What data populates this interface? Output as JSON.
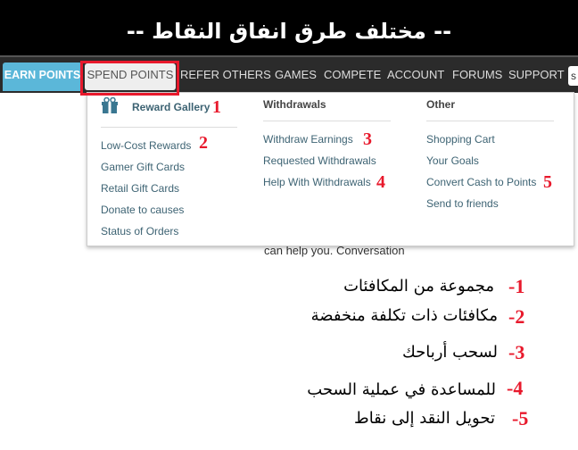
{
  "title": "-- مختلف طرق انفاق النقاط --",
  "nav": {
    "items": [
      "EARN POINTS",
      "SPEND POINTS",
      "REFER OTHERS",
      "GAMES",
      "COMPETE",
      "ACCOUNT",
      "FORUMS",
      "SUPPORT"
    ],
    "search_partial": "s"
  },
  "dropdown": {
    "col1": {
      "header": "Reward Gallery",
      "items": [
        "Low-Cost Rewards",
        "Gamer Gift Cards",
        "Retail Gift Cards",
        "Donate to causes",
        "Status of Orders"
      ]
    },
    "col2": {
      "header": "Withdrawals",
      "items": [
        "Withdraw Earnings",
        "Requested Withdrawals",
        "Help With Withdrawals"
      ]
    },
    "col3": {
      "header": "Other",
      "items": [
        "Shopping Cart",
        "Your Goals",
        "Convert Cash to Points",
        "Send to friends"
      ]
    },
    "markers": [
      "1",
      "2",
      "3",
      "4",
      "5"
    ]
  },
  "behind_text": "can help you. Conversation",
  "legend": [
    {
      "num": "-1",
      "text": "مجموعة من المكافئات"
    },
    {
      "num": "-2",
      "text": "مكافئات ذات تكلفة منخفضة"
    },
    {
      "num": "-3",
      "text": "لسحب أرباحك"
    },
    {
      "num": "-4",
      "text": "للمساعدة في عملية السحب"
    },
    {
      "num": "-5",
      "text": "تحويل النقد إلى نقاط"
    }
  ],
  "colors": {
    "accent": "#5bb7d9",
    "highlight": "#e8192c",
    "link": "#3d6373"
  }
}
